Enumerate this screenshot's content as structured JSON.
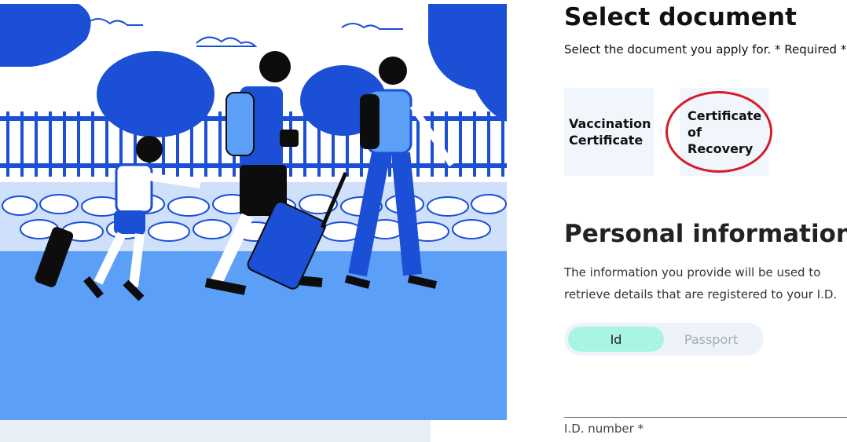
{
  "illustration": {
    "icon": "family-travel-illustration",
    "colors": {
      "primary": "#1a4fd6",
      "light": "#60a0f8",
      "dark": "#0d0d0d",
      "sky": "#ffffff",
      "ground": "#5c9ff7"
    }
  },
  "select_document": {
    "title": "Select document",
    "subtitle": "Select the document you apply for. * Required  *",
    "options": [
      {
        "label": "Vaccination Certificate"
      },
      {
        "label": "Certificate of Recovery",
        "highlighted": true
      }
    ],
    "highlight_color": "#d41c2a"
  },
  "personal_info": {
    "title": "Personal information",
    "description": "The information you provide will be used to retrieve details that are registered to your I.D.",
    "id_type_toggle": {
      "options": [
        "Id",
        "Passport"
      ],
      "selected": "Id",
      "selected_color": "#a8f5e3"
    },
    "id_number_label": "I.D. number *"
  }
}
